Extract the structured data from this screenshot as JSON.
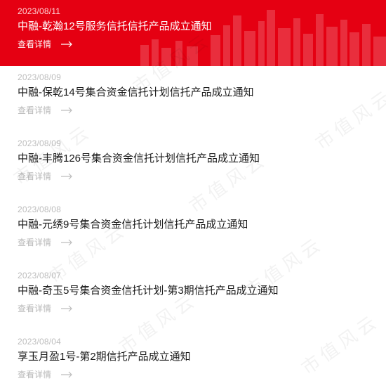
{
  "news": {
    "items": [
      {
        "date": "2023/08/11",
        "title": "中融-乾瀚12号服务信托信托产品成立通知",
        "more": "查看详情"
      },
      {
        "date": "2023/08/09",
        "title": "中融-保乾14号集合资金信托计划信托产品成立通知",
        "more": "查看详情"
      },
      {
        "date": "2023/08/09",
        "title": "中融-丰腾126号集合资金信托计划信托产品成立通知",
        "more": "查看详情"
      },
      {
        "date": "2023/08/08",
        "title": "中融-元绣9号集合资金信托计划信托产品成立通知",
        "more": "查看详情"
      },
      {
        "date": "2023/08/07",
        "title": "中融-奇玉5号集合资金信托计划-第3期信托产品成立通知",
        "more": "查看详情"
      },
      {
        "date": "2023/08/04",
        "title": "享玉月盈1号-第2期信托产品成立通知",
        "more": "查看详情"
      }
    ]
  },
  "watermark": {
    "text": "市值风云"
  },
  "colors": {
    "accent": "#e50012",
    "date": "#bdbdbd",
    "title": "#1a1a1a",
    "more": "#b8b8b8"
  },
  "icons": {
    "more_arrow": "arrow-right-icon",
    "skyline": "city-skyline-decoration"
  }
}
